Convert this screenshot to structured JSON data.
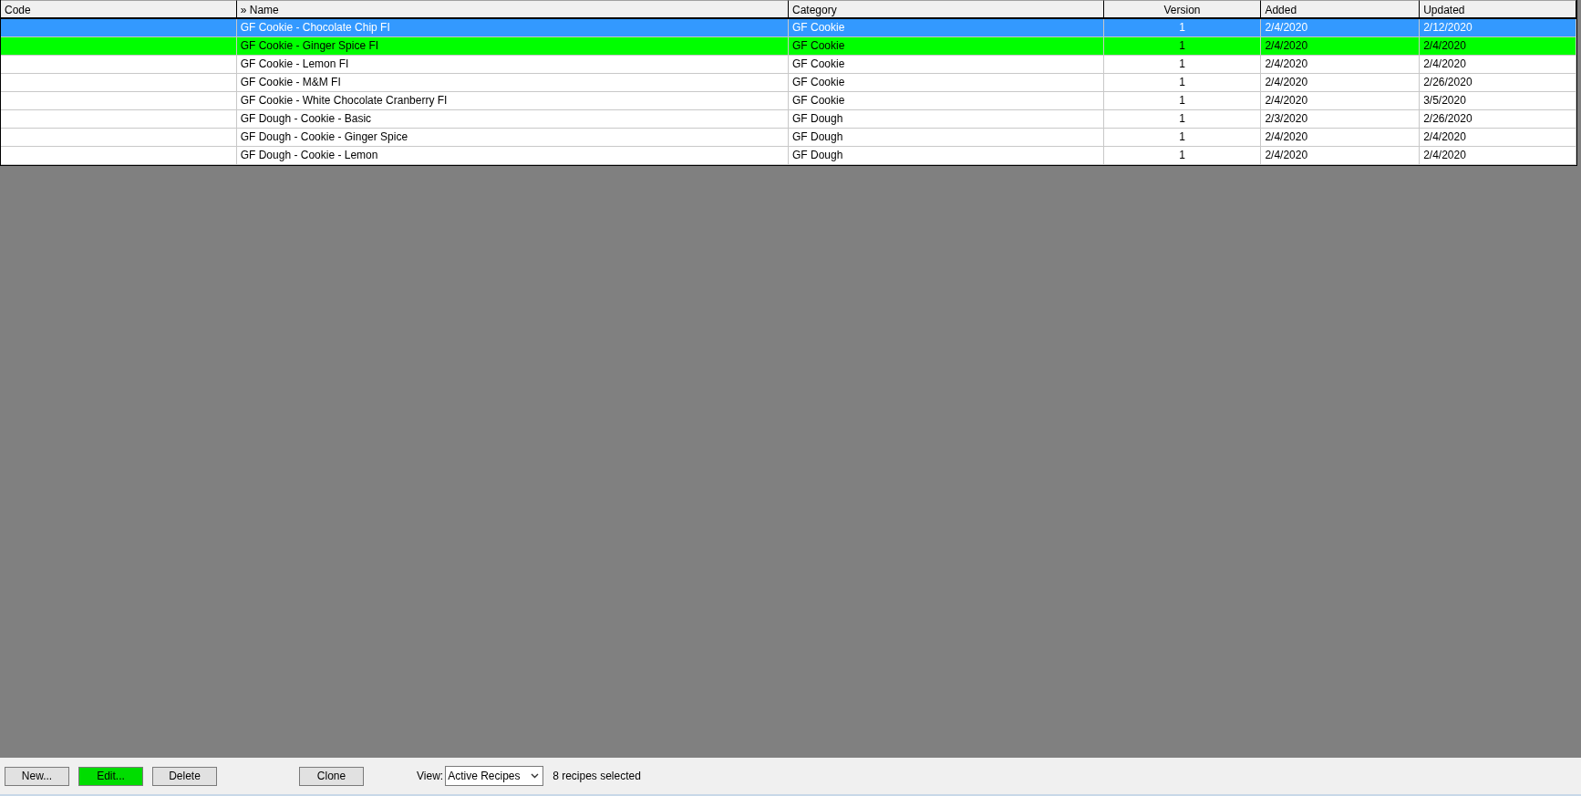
{
  "table": {
    "columns": [
      {
        "label": "Code",
        "kind": "text"
      },
      {
        "label": "» Name",
        "kind": "text"
      },
      {
        "label": "Category",
        "kind": "text"
      },
      {
        "label": "Version",
        "kind": "number"
      },
      {
        "label": "Added",
        "kind": "text"
      },
      {
        "label": "Updated",
        "kind": "text"
      }
    ],
    "rows": [
      {
        "cells": [
          "",
          "GF Cookie - Chocolate Chip FI",
          "GF Cookie",
          "1",
          "2/4/2020",
          "2/12/2020"
        ],
        "selected": true
      },
      {
        "cells": [
          "",
          "GF Cookie - Ginger Spice FI",
          "GF Cookie",
          "1",
          "2/4/2020",
          "2/4/2020"
        ],
        "selected": false,
        "color": "#00ff00"
      },
      {
        "cells": [
          "",
          "GF Cookie - Lemon FI",
          "GF Cookie",
          "1",
          "2/4/2020",
          "2/4/2020"
        ],
        "selected": false
      },
      {
        "cells": [
          "",
          "GF Cookie - M&M FI",
          "GF Cookie",
          "1",
          "2/4/2020",
          "2/26/2020"
        ],
        "selected": false
      },
      {
        "cells": [
          "",
          "GF Cookie - White Chocolate Cranberry FI",
          "GF Cookie",
          "1",
          "2/4/2020",
          "3/5/2020"
        ],
        "selected": false
      },
      {
        "cells": [
          "",
          "GF Dough - Cookie - Basic",
          "GF Dough",
          "1",
          "2/3/2020",
          "2/26/2020"
        ],
        "selected": false
      },
      {
        "cells": [
          "",
          "GF Dough - Cookie - Ginger Spice",
          "GF Dough",
          "1",
          "2/4/2020",
          "2/4/2020"
        ],
        "selected": false
      },
      {
        "cells": [
          "",
          "GF Dough - Cookie - Lemon",
          "GF Dough",
          "1",
          "2/4/2020",
          "2/4/2020"
        ],
        "selected": false
      }
    ]
  },
  "toolbar": {
    "button_groups": [
      [
        {
          "label": "New..."
        },
        {
          "label": "Edit...",
          "color": "#00dd00"
        },
        {
          "label": "Delete"
        }
      ],
      [
        {
          "label": "Clone"
        }
      ]
    ],
    "view_label": "View:",
    "view_value": "Active Recipes",
    "status": "8 recipes selected"
  }
}
